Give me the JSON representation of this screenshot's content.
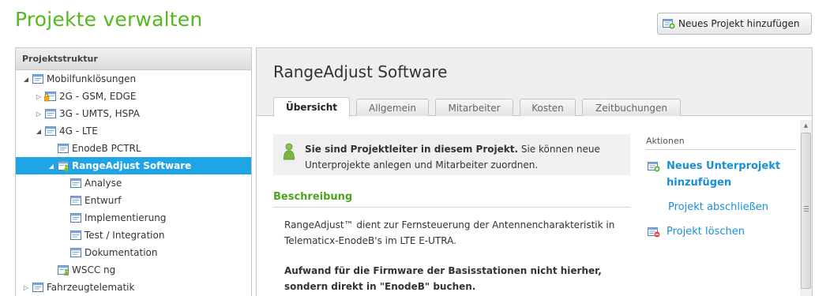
{
  "page": {
    "title": "Projekte verwalten",
    "add_project_label": "Neues Projekt hinzufügen"
  },
  "tree": {
    "header": "Projektstruktur",
    "items": [
      {
        "label": "Mobilfunklösungen",
        "level": 0,
        "expander": "open",
        "icon": "project-icon"
      },
      {
        "label": "2G - GSM, EDGE",
        "level": 1,
        "expander": "closed",
        "icon": "locked-project-icon"
      },
      {
        "label": "3G - UMTS, HSPA",
        "level": 1,
        "expander": "closed",
        "icon": "project-icon"
      },
      {
        "label": "4G - LTE",
        "level": 1,
        "expander": "open",
        "icon": "project-icon"
      },
      {
        "label": "EnodeB PCTRL",
        "level": 2,
        "expander": "none",
        "icon": "project-icon"
      },
      {
        "label": "RangeAdjust Software",
        "level": 2,
        "expander": "open",
        "icon": "leader-project-icon",
        "selected": true
      },
      {
        "label": "Analyse",
        "level": 3,
        "expander": "none",
        "icon": "project-icon"
      },
      {
        "label": "Entwurf",
        "level": 3,
        "expander": "none",
        "icon": "project-icon"
      },
      {
        "label": "Implementierung",
        "level": 3,
        "expander": "none",
        "icon": "project-icon"
      },
      {
        "label": "Test / Integration",
        "level": 3,
        "expander": "none",
        "icon": "project-icon"
      },
      {
        "label": "Dokumentation",
        "level": 3,
        "expander": "none",
        "icon": "project-icon"
      },
      {
        "label": "WSCC ng",
        "level": 2,
        "expander": "none",
        "icon": "leader-project-icon"
      },
      {
        "label": "Fahrzeugtelematik",
        "level": 0,
        "expander": "closed",
        "icon": "project-icon"
      }
    ]
  },
  "project": {
    "title": "RangeAdjust Software",
    "tabs": [
      "Übersicht",
      "Allgemein",
      "Mitarbeiter",
      "Kosten",
      "Zeitbuchungen"
    ],
    "active_tab": "Übersicht",
    "info_bold": "Sie sind Projektleiter in diesem Projekt.",
    "info_rest": " Sie können neue Unterprojekte anlegen und Mitarbeiter zuordnen.",
    "description_heading": "Beschreibung",
    "description_text": "RangeAdjust™ dient zur Fernsteuerung der Antennencharakteristik in Telematicx-EnodeB's im LTE E-UTRA.",
    "description_note": "Aufwand für die Firmware der Basisstationen nicht hierher, sondern direkt in \"EnodeB\" buchen."
  },
  "actions": {
    "title": "Aktionen",
    "items": [
      {
        "label": "Neues Unterprojekt hinzufügen",
        "icon": "add-subproject-icon",
        "bold": true
      },
      {
        "label": "Projekt abschließen",
        "icon": "",
        "bold": false
      },
      {
        "label": "Projekt löschen",
        "icon": "delete-project-icon",
        "bold": false
      }
    ]
  },
  "colors": {
    "title_green": "#55b81f",
    "heading_green": "#4aa51c",
    "link_blue": "#1a8fd6",
    "selection_blue": "#1fa4e6"
  }
}
